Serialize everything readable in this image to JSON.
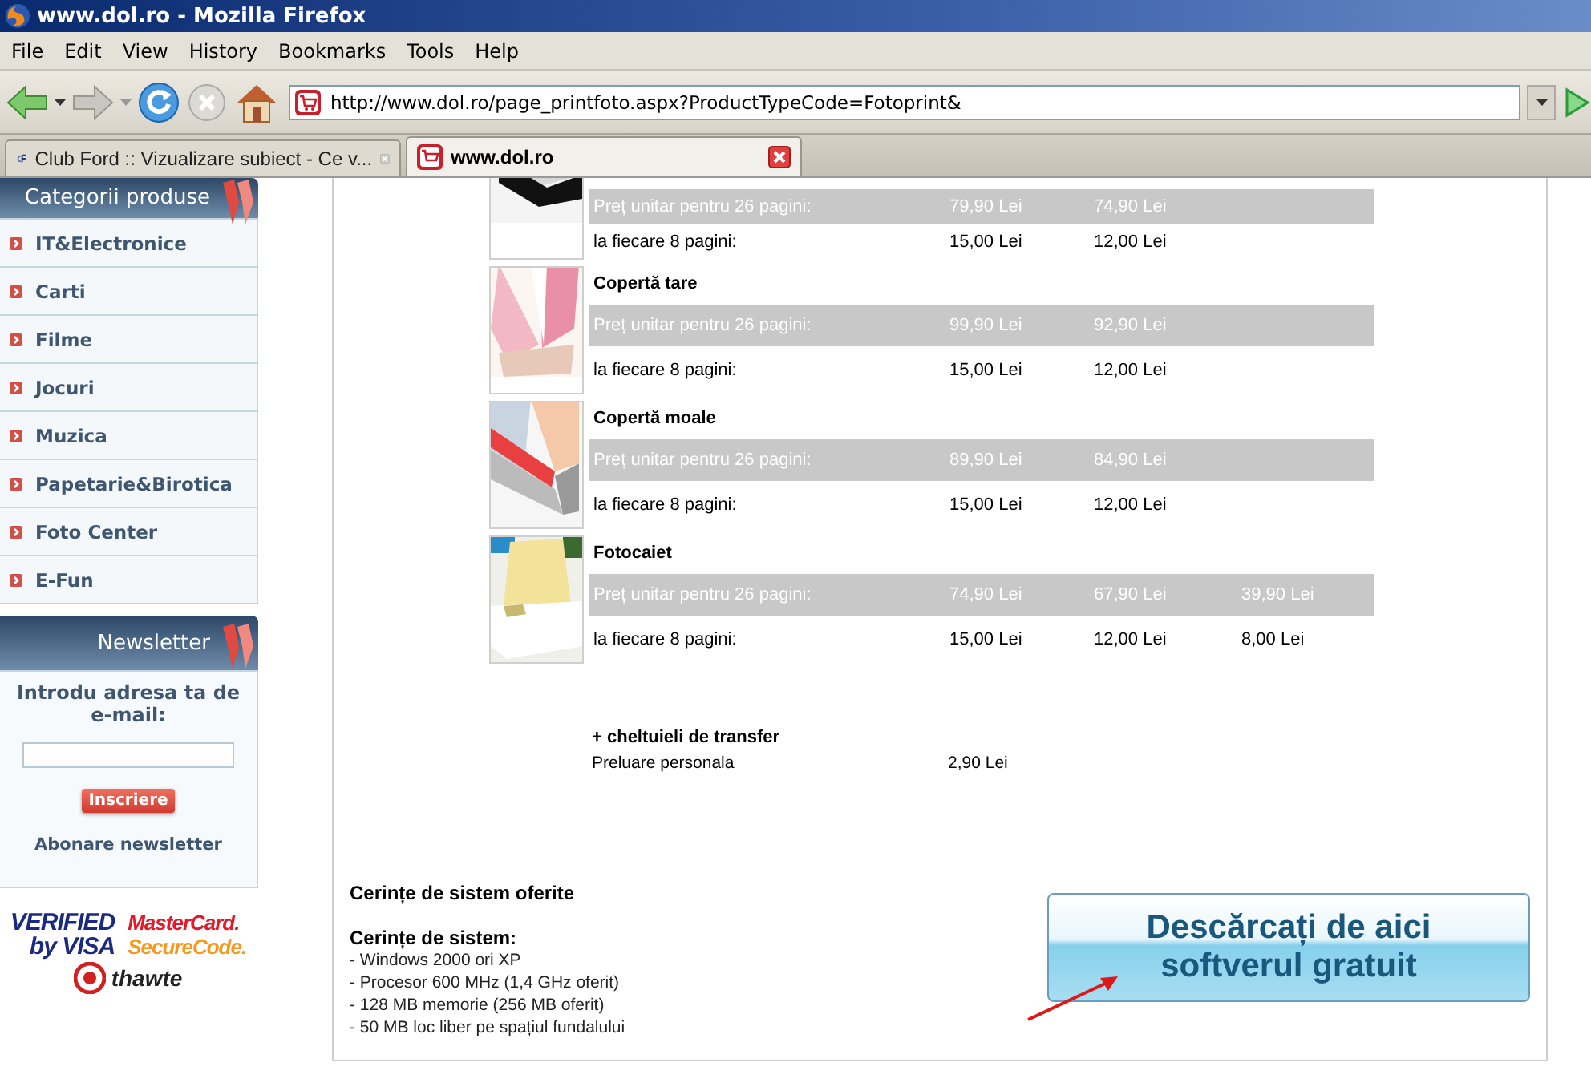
{
  "window": {
    "title": "www.dol.ro - Mozilla Firefox"
  },
  "menu": [
    "File",
    "Edit",
    "View",
    "History",
    "Bookmarks",
    "Tools",
    "Help"
  ],
  "address_bar": {
    "value": "http://www.dol.ro/page_printfoto.aspx?ProductTypeCode=Fotoprint&"
  },
  "tabs": [
    {
      "label": "Club Ford :: Vizualizare subiect - Ce v...",
      "selected": false
    },
    {
      "label": "www.dol.ro",
      "selected": true
    }
  ],
  "sidebar": {
    "categories_title": "Categorii produse",
    "categories": [
      "IT&Electronice",
      "Carti",
      "Filme",
      "Jocuri",
      "Muzica",
      "Papetarie&Birotica",
      "Foto Center",
      "E-Fun"
    ],
    "newsletter": {
      "title": "Newsletter",
      "prompt": "Introdu adresa ta de e-mail:",
      "subscribe_button": "Inscriere",
      "link": "Abonare newsletter"
    },
    "payment_logos": [
      {
        "kind": "visa",
        "lines": [
          "VERIFIED",
          "by VISA"
        ]
      },
      {
        "kind": "mastercard",
        "lines": [
          "MasterCard.",
          "SecureCode."
        ]
      },
      {
        "kind": "thawte",
        "lines": [
          "thawte"
        ]
      }
    ]
  },
  "products": [
    {
      "unit_label": "Preț unitar pentru 26 pagini:",
      "unit_prices": [
        "79,90 Lei",
        "74,90 Lei"
      ],
      "extra_label": "la fiecare 8 pagini:",
      "extra_prices": [
        "15,00 Lei",
        "12,00 Lei"
      ]
    },
    {
      "name": "Copertă tare",
      "unit_label": "Preț unitar pentru 26 pagini:",
      "unit_prices": [
        "99,90 Lei",
        "92,90 Lei"
      ],
      "extra_label": "la fiecare 8 pagini:",
      "extra_prices": [
        "15,00 Lei",
        "12,00 Lei"
      ]
    },
    {
      "name": "Copertă moale",
      "unit_label": "Preț unitar pentru 26 pagini:",
      "unit_prices": [
        "89,90 Lei",
        "84,90 Lei"
      ],
      "extra_label": "la fiecare 8 pagini:",
      "extra_prices": [
        "15,00 Lei",
        "12,00 Lei"
      ]
    },
    {
      "name": "Fotocaiet",
      "unit_label": "Preț unitar pentru 26 pagini:",
      "unit_prices": [
        "74,90 Lei",
        "67,90 Lei",
        "39,90 Lei"
      ],
      "extra_label": "la fiecare 8 pagini:",
      "extra_prices": [
        "15,00 Lei",
        "12,00 Lei",
        "8,00 Lei"
      ]
    }
  ],
  "transfer": {
    "title": "+ cheltuieli de transfer",
    "rows": [
      {
        "label": "Preluare personala",
        "price": "2,90 Lei"
      }
    ]
  },
  "requirements": {
    "title": "Cerințe de sistem oferite",
    "subtitle": "Cerințe de sistem:",
    "items": [
      "- Windows 2000 ori XP",
      "- Procesor 600 MHz (1,4 GHz oferit)",
      "- 128 MB memorie (256 MB oferit)",
      "- 50 MB loc liber pe spațiul fundalului"
    ]
  },
  "download_button": {
    "lines": [
      "Descărcați de aici",
      "softverul gratuit"
    ]
  }
}
